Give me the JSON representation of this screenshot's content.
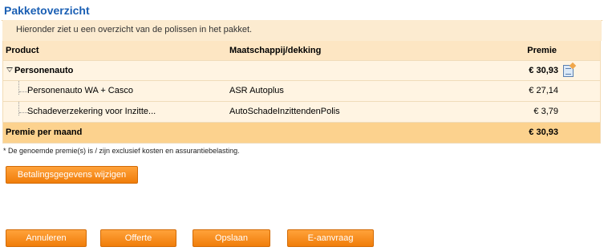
{
  "page": {
    "title": "Pakketoverzicht",
    "intro": "Hieronder ziet u een overzicht van de polissen in het pakket."
  },
  "table": {
    "headers": {
      "product": "Product",
      "maatschappij": "Maatschappij/dekking",
      "premie": "Premie"
    },
    "group": {
      "label": "Personenauto",
      "premie": "€ 30,93"
    },
    "items": [
      {
        "product": "Personenauto WA + Casco",
        "maatschappij": "ASR Autoplus",
        "premie": "€ 27,14"
      },
      {
        "product": "Schadeverzekering voor Inzitte...",
        "maatschappij": "AutoSchadeInzittendenPolis",
        "premie": "€ 3,79"
      }
    ],
    "total": {
      "label": "Premie per maand",
      "premie": "€ 30,93"
    }
  },
  "footnote": "* De genoemde premie(s) is / zijn exclusief kosten en assurantiebelasting.",
  "buttons": {
    "betaalgegevens": "Betalingsgegevens wijzigen",
    "annuleren": "Annuleren",
    "offerte": "Offerte",
    "opslaan": "Opslaan",
    "eaanvraag": "E-aanvraag"
  },
  "icons": {
    "group_collapse": "triangle-down-icon",
    "group_document": "document-icon"
  },
  "colors": {
    "title": "#1a5fb4",
    "button": "#f07d0a",
    "total_row": "#fcd28e",
    "header_row": "#fde6c3"
  }
}
